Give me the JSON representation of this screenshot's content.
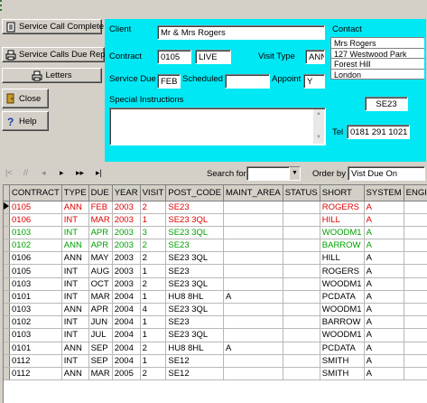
{
  "buttons": {
    "service_call_complete": "Service Call Complete",
    "service_calls_due_report": "Service Calls Due Report",
    "letters": "Letters",
    "close": "Close",
    "help": "Help"
  },
  "form": {
    "client_label": "Client",
    "client_value": "Mr & Mrs Rogers",
    "contract_label": "Contract",
    "contract_value": "0105",
    "contract_status": "LIVE",
    "visit_type_label": "Visit Type",
    "visit_type_value": "ANN",
    "service_due_label": "Service Due",
    "service_due_value": "FEB",
    "scheduled_label": "Scheduled",
    "scheduled_value": "",
    "appoint_label": "Appoint",
    "appoint_value": "Y",
    "special_instructions_label": "Special Instructions",
    "special_instructions_value": "",
    "contact_label": "Contact",
    "address_lines": [
      "Mrs Rogers",
      "127 Westwood Park",
      "Forest Hill",
      "London"
    ],
    "postcode": "SE23",
    "tel_label": "Tel",
    "tel_value": "0181 291 1021"
  },
  "toolbar": {
    "search_for_label": "Search for",
    "search_for_value": "",
    "order_by_label": "Order by",
    "order_by_value": "Vist Due On"
  },
  "table": {
    "columns": [
      "CONTRACT",
      "TYPE",
      "DUE",
      "YEAR",
      "VISIT",
      "POST_CODE",
      "MAINT_AREA",
      "STATUS",
      "SHORT",
      "SYSTEM",
      "ENGINEER"
    ],
    "rows": [
      {
        "color": "red",
        "current": true,
        "cells": [
          "0105",
          "ANN",
          "FEB",
          "2003",
          "2",
          "SE23",
          "",
          "",
          "ROGERS",
          "A",
          ""
        ]
      },
      {
        "color": "red",
        "cells": [
          "0106",
          "INT",
          "MAR",
          "2003",
          "1",
          "SE23 3QL",
          "",
          "",
          "HILL",
          "A",
          ""
        ]
      },
      {
        "color": "green",
        "cells": [
          "0103",
          "INT",
          "APR",
          "2003",
          "3",
          "SE23 3QL",
          "",
          "",
          "WOODM1",
          "A",
          ""
        ]
      },
      {
        "color": "green",
        "cells": [
          "0102",
          "ANN",
          "APR",
          "2003",
          "2",
          "SE23",
          "",
          "",
          "BARROW",
          "A",
          ""
        ]
      },
      {
        "color": "black",
        "cells": [
          "0106",
          "ANN",
          "MAY",
          "2003",
          "2",
          "SE23 3QL",
          "",
          "",
          "HILL",
          "A",
          ""
        ]
      },
      {
        "color": "black",
        "cells": [
          "0105",
          "INT",
          "AUG",
          "2003",
          "1",
          "SE23",
          "",
          "",
          "ROGERS",
          "A",
          ""
        ]
      },
      {
        "color": "black",
        "cells": [
          "0103",
          "INT",
          "OCT",
          "2003",
          "2",
          "SE23 3QL",
          "",
          "",
          "WOODM1",
          "A",
          ""
        ]
      },
      {
        "color": "black",
        "cells": [
          "0101",
          "INT",
          "MAR",
          "2004",
          "1",
          "HU8 8HL",
          "A",
          "",
          "PCDATA",
          "A",
          ""
        ]
      },
      {
        "color": "black",
        "cells": [
          "0103",
          "ANN",
          "APR",
          "2004",
          "4",
          "SE23 3QL",
          "",
          "",
          "WOODM1",
          "A",
          ""
        ]
      },
      {
        "color": "black",
        "cells": [
          "0102",
          "INT",
          "JUN",
          "2004",
          "1",
          "SE23",
          "",
          "",
          "BARROW",
          "A",
          ""
        ]
      },
      {
        "color": "black",
        "cells": [
          "0103",
          "INT",
          "JUL",
          "2004",
          "1",
          "SE23 3QL",
          "",
          "",
          "WOODM1",
          "A",
          ""
        ]
      },
      {
        "color": "black",
        "cells": [
          "0101",
          "ANN",
          "SEP",
          "2004",
          "2",
          "HU8 8HL",
          "A",
          "",
          "PCDATA",
          "A",
          ""
        ]
      },
      {
        "color": "black",
        "cells": [
          "0112",
          "INT",
          "SEP",
          "2004",
          "1",
          "SE12",
          "",
          "",
          "SMITH",
          "A",
          ""
        ]
      },
      {
        "color": "black",
        "cells": [
          "0112",
          "ANN",
          "MAR",
          "2005",
          "2",
          "SE12",
          "",
          "",
          "SMITH",
          "A",
          ""
        ]
      }
    ]
  }
}
